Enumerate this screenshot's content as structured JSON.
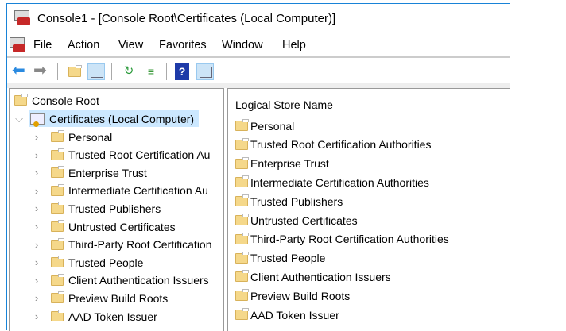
{
  "window": {
    "title": "Console1 - [Console Root\\Certificates (Local Computer)]"
  },
  "menu": [
    "File",
    "Action",
    "View",
    "Favorites",
    "Window",
    "Help"
  ],
  "toolbar": [
    "back-icon",
    "forward-icon",
    "up-one-level-icon",
    "show-hide-console-tree-icon",
    "refresh-icon",
    "export-list-icon",
    "help-icon",
    "show-hide-action-pane-icon"
  ],
  "tree": {
    "root": "Console Root",
    "certificates": "Certificates (Local Computer)",
    "items": [
      "Personal",
      "Trusted Root Certification Au",
      "Enterprise Trust",
      "Intermediate Certification Au",
      "Trusted Publishers",
      "Untrusted Certificates",
      "Third-Party Root Certification",
      "Trusted People",
      "Client Authentication Issuers",
      "Preview Build Roots",
      "AAD Token Issuer"
    ]
  },
  "list": {
    "header": "Logical Store Name",
    "items": [
      "Personal",
      "Trusted Root Certification Authorities",
      "Enterprise Trust",
      "Intermediate Certification Authorities",
      "Trusted Publishers",
      "Untrusted Certificates",
      "Third-Party Root Certification Authorities",
      "Trusted People",
      "Client Authentication Issuers",
      "Preview Build Roots",
      "AAD Token Issuer"
    ]
  },
  "colors": {
    "accent": "#1883d7",
    "selection": "#cce8ff",
    "folder": "#f5d88a"
  }
}
